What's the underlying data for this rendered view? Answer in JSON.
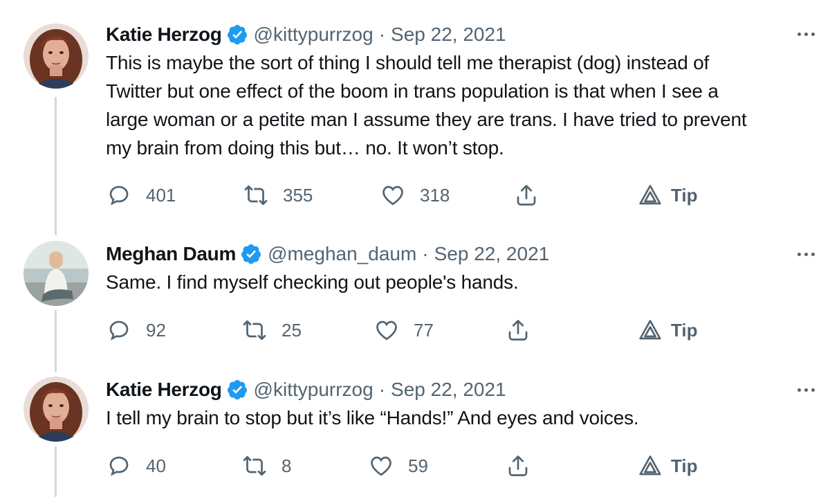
{
  "tweets": [
    {
      "name": "Katie Herzog",
      "handle": "@kittypurrzog",
      "separator": "·",
      "date": "Sep 22, 2021",
      "text": "This is maybe the sort of thing I should tell me therapist (dog) instead of\nTwitter but one effect of the boom in trans population is that when I see a\nlarge woman or a petite man I assume they are trans. I have tried to prevent\nmy brain from doing this but… no. It won’t stop.",
      "replies": "401",
      "retweets": "355",
      "likes": "318",
      "tip_label": "Tip",
      "avatar_icon": "profile-photo"
    },
    {
      "name": "Meghan Daum",
      "handle": "@meghan_daum",
      "separator": "·",
      "date": "Sep 22, 2021",
      "text": "Same. I find myself checking out people's hands.",
      "replies": "92",
      "retweets": "25",
      "likes": "77",
      "tip_label": "Tip",
      "avatar_icon": "profile-photo"
    },
    {
      "name": "Katie Herzog",
      "handle": "@kittypurrzog",
      "separator": "·",
      "date": "Sep 22, 2021",
      "text": "I tell my brain to stop but it’s like “Hands!” And eyes and voices.",
      "replies": "40",
      "retweets": "8",
      "likes": "59",
      "tip_label": "Tip",
      "avatar_icon": "profile-photo"
    }
  ],
  "colors": {
    "text": "#0f1419",
    "secondary": "#536471",
    "verified": "#1d9bf0",
    "thread_line": "#cfd9de"
  }
}
